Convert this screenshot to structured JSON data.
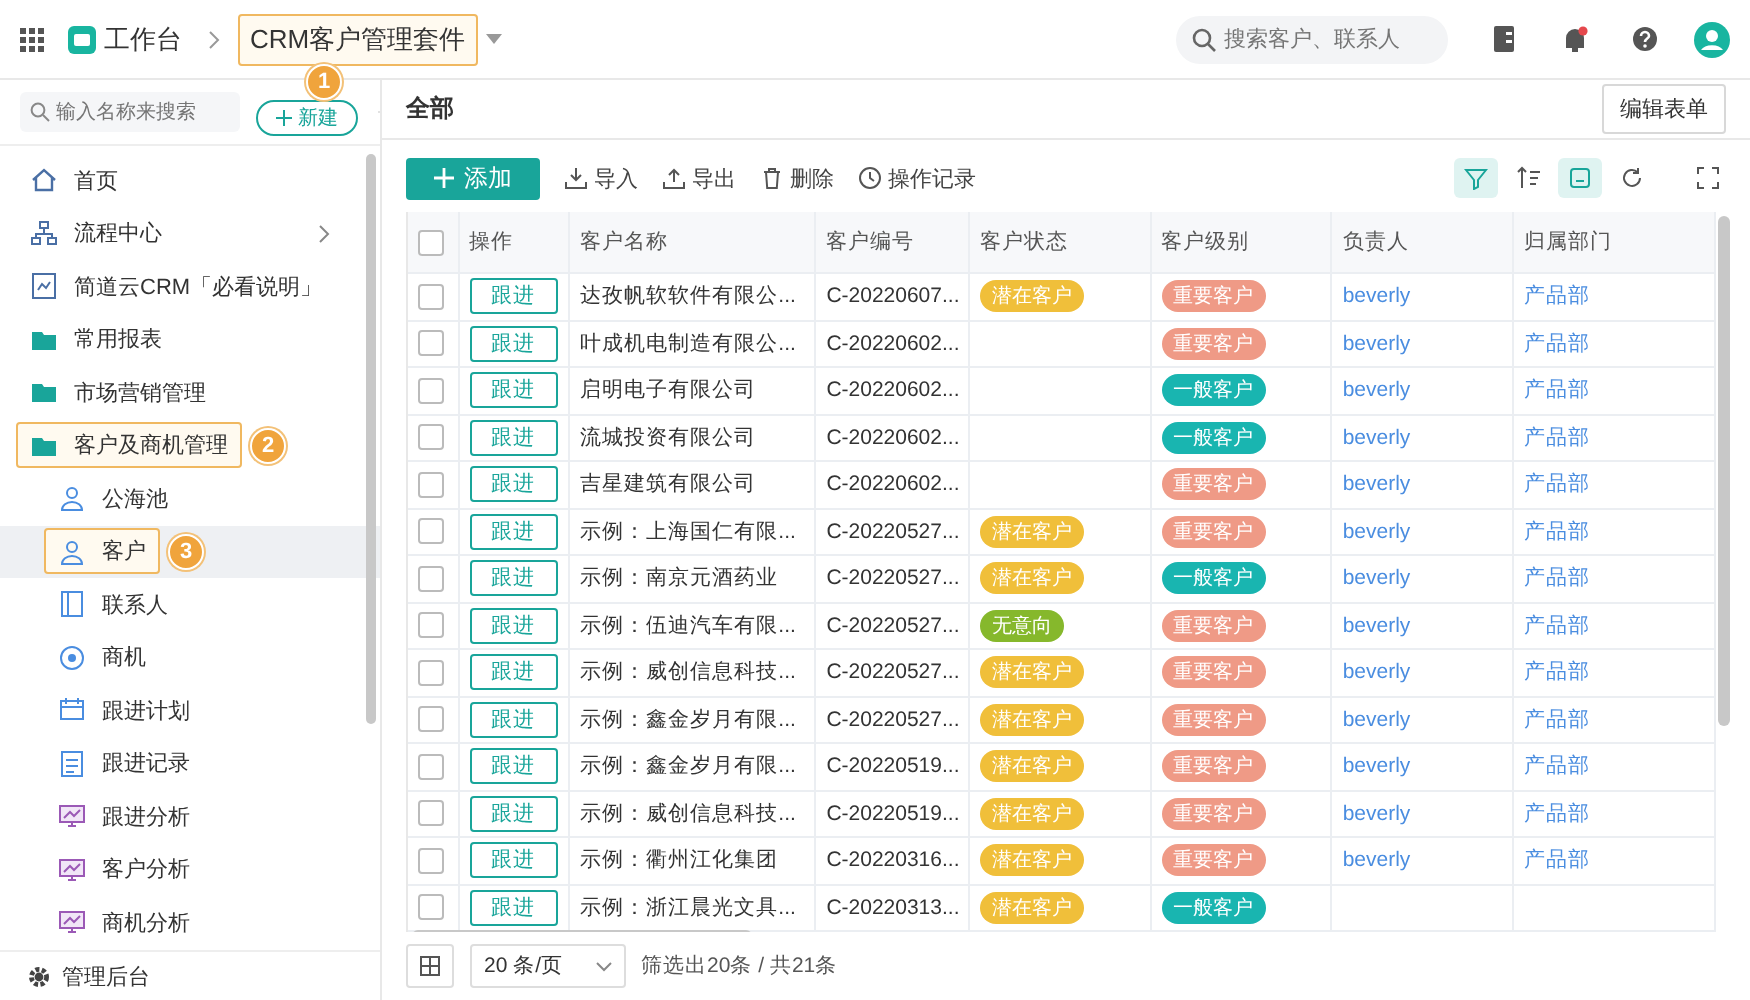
{
  "topbar": {
    "app_label": "工作台",
    "suite": {
      "text": "CRM客户管理套件",
      "marker": "1"
    },
    "search": {
      "placeholder": "搜索客户、联系人"
    }
  },
  "sidebar": {
    "search": {
      "placeholder": "输入名称来搜索"
    },
    "new_button": "新建",
    "items": [
      {
        "label": "首页",
        "kind": "home",
        "submenu": false,
        "selected": false
      },
      {
        "label": "流程中心",
        "kind": "process",
        "submenu": true,
        "selected": false
      },
      {
        "label": "简道云CRM「必看说明」",
        "kind": "guide",
        "submenu": false,
        "selected": false
      },
      {
        "label": "常用报表",
        "kind": "group",
        "submenu": false,
        "selected": false
      },
      {
        "label": "市场营销管理",
        "kind": "group",
        "submenu": false,
        "selected": false
      },
      {
        "label": "客户及商机管理",
        "kind": "group",
        "submenu": false,
        "selected": false,
        "marker": "2",
        "children": [
          {
            "label": "公海池",
            "kind": "pool",
            "selected": false
          },
          {
            "label": "客户",
            "kind": "customer",
            "selected": true,
            "marker": "3"
          },
          {
            "label": "联系人",
            "kind": "contact",
            "selected": false
          },
          {
            "label": "商机",
            "kind": "opportunity",
            "selected": false
          },
          {
            "label": "跟进计划",
            "kind": "plan",
            "selected": false
          },
          {
            "label": "跟进记录",
            "kind": "record",
            "selected": false
          },
          {
            "label": "跟进分析",
            "kind": "analysis",
            "selected": false
          },
          {
            "label": "客户分析",
            "kind": "analysis",
            "selected": false
          },
          {
            "label": "商机分析",
            "kind": "analysis",
            "selected": false
          }
        ]
      }
    ],
    "footer": "管理后台"
  },
  "main": {
    "title": "全部",
    "edit_button": "编辑表单"
  },
  "toolbar": {
    "add_button": "添加",
    "actions": [
      {
        "label": "导入",
        "kind": "import"
      },
      {
        "label": "导出",
        "kind": "export"
      },
      {
        "label": "删除",
        "kind": "delete"
      },
      {
        "label": "操作记录",
        "kind": "log"
      }
    ],
    "tools": [
      {
        "kind": "filter",
        "on": true
      },
      {
        "kind": "sort",
        "on": false
      },
      {
        "kind": "card",
        "on": true
      },
      {
        "kind": "refresh",
        "on": false
      },
      {
        "kind": "fullscreen",
        "on": false
      }
    ]
  },
  "table": {
    "select_all": {
      "checked": false
    },
    "columns": [
      "操作",
      "客户名称",
      "客户编号",
      "客户状态",
      "客户级别",
      "负责人",
      "归属部门"
    ],
    "rows": [
      {
        "checked": false,
        "action": "跟进",
        "name": "达孜帆软软件有限公...",
        "code": "C-20220607...",
        "status": {
          "text": "潜在客户",
          "color": "#f0bf3a"
        },
        "level": {
          "text": "重要客户",
          "color": "#ef9a86"
        },
        "owner": "beverly",
        "dept": "产品部"
      },
      {
        "checked": false,
        "action": "跟进",
        "name": "叶成机电制造有限公...",
        "code": "C-20220602...",
        "level": {
          "text": "重要客户",
          "color": "#ef9a86"
        },
        "owner": "beverly",
        "dept": "产品部"
      },
      {
        "checked": false,
        "action": "跟进",
        "name": "启明电子有限公司",
        "code": "C-20220602...",
        "level": {
          "text": "一般客户",
          "color": "#19b5b0"
        },
        "owner": "beverly",
        "dept": "产品部"
      },
      {
        "checked": false,
        "action": "跟进",
        "name": "流城投资有限公司",
        "code": "C-20220602...",
        "level": {
          "text": "一般客户",
          "color": "#19b5b0"
        },
        "owner": "beverly",
        "dept": "产品部"
      },
      {
        "checked": false,
        "action": "跟进",
        "name": "吉星建筑有限公司",
        "code": "C-20220602...",
        "level": {
          "text": "重要客户",
          "color": "#ef9a86"
        },
        "owner": "beverly",
        "dept": "产品部"
      },
      {
        "checked": false,
        "action": "跟进",
        "name": "示例：上海国仁有限...",
        "code": "C-20220527...",
        "status": {
          "text": "潜在客户",
          "color": "#f0bf3a"
        },
        "level": {
          "text": "重要客户",
          "color": "#ef9a86"
        },
        "owner": "beverly",
        "dept": "产品部"
      },
      {
        "checked": false,
        "action": "跟进",
        "name": "示例：南京元酒药业",
        "code": "C-20220527...",
        "status": {
          "text": "潜在客户",
          "color": "#f0bf3a"
        },
        "level": {
          "text": "一般客户",
          "color": "#19b5b0"
        },
        "owner": "beverly",
        "dept": "产品部"
      },
      {
        "checked": false,
        "action": "跟进",
        "name": "示例：伍迪汽车有限...",
        "code": "C-20220527...",
        "status": {
          "text": "无意向",
          "color": "#86b82c"
        },
        "level": {
          "text": "重要客户",
          "color": "#ef9a86"
        },
        "owner": "beverly",
        "dept": "产品部"
      },
      {
        "checked": false,
        "action": "跟进",
        "name": "示例：威创信息科技...",
        "code": "C-20220527...",
        "status": {
          "text": "潜在客户",
          "color": "#f0bf3a"
        },
        "level": {
          "text": "重要客户",
          "color": "#ef9a86"
        },
        "owner": "beverly",
        "dept": "产品部"
      },
      {
        "checked": false,
        "action": "跟进",
        "name": "示例：鑫金岁月有限...",
        "code": "C-20220527...",
        "status": {
          "text": "潜在客户",
          "color": "#f0bf3a"
        },
        "level": {
          "text": "重要客户",
          "color": "#ef9a86"
        },
        "owner": "beverly",
        "dept": "产品部"
      },
      {
        "checked": false,
        "action": "跟进",
        "name": "示例：鑫金岁月有限...",
        "code": "C-20220519...",
        "status": {
          "text": "潜在客户",
          "color": "#f0bf3a"
        },
        "level": {
          "text": "重要客户",
          "color": "#ef9a86"
        },
        "owner": "beverly",
        "dept": "产品部"
      },
      {
        "checked": false,
        "action": "跟进",
        "name": "示例：威创信息科技...",
        "code": "C-20220519...",
        "status": {
          "text": "潜在客户",
          "color": "#f0bf3a"
        },
        "level": {
          "text": "重要客户",
          "color": "#ef9a86"
        },
        "owner": "beverly",
        "dept": "产品部"
      },
      {
        "checked": false,
        "action": "跟进",
        "name": "示例：衢州江化集团",
        "code": "C-20220316...",
        "status": {
          "text": "潜在客户",
          "color": "#f0bf3a"
        },
        "level": {
          "text": "重要客户",
          "color": "#ef9a86"
        },
        "owner": "beverly",
        "dept": "产品部"
      },
      {
        "checked": false,
        "action": "跟进",
        "name": "示例：浙江晨光文具...",
        "code": "C-20220313...",
        "status": {
          "text": "潜在客户",
          "color": "#f0bf3a"
        },
        "level": {
          "text": "一般客户",
          "color": "#19b5b0"
        }
      }
    ]
  },
  "footer": {
    "page_size": "20 条/页",
    "summary": "筛选出20条 / 共21条"
  }
}
